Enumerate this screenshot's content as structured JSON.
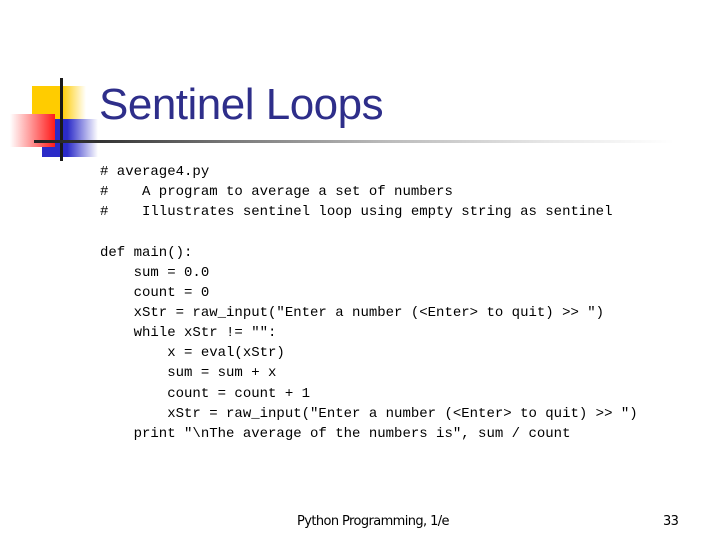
{
  "slide": {
    "title": "Sentinel Loops",
    "code_lines": [
      "# average4.py",
      "#    A program to average a set of numbers",
      "#    Illustrates sentinel loop using empty string as sentinel",
      "",
      "def main():",
      "    sum = 0.0",
      "    count = 0",
      "    xStr = raw_input(\"Enter a number (<Enter> to quit) >> \")",
      "    while xStr != \"\":",
      "        x = eval(xStr)",
      "        sum = sum + x",
      "        count = count + 1",
      "        xStr = raw_input(\"Enter a number (<Enter> to quit) >> \")",
      "    print \"\\nThe average of the numbers is\", sum / count"
    ],
    "footer": {
      "text": "Python Programming, 1/e",
      "page_number": "33"
    },
    "colors": {
      "title": "#2e2e8a",
      "logo_yellow": "#ffcc00",
      "logo_red": "#ff1a1a",
      "logo_blue": "#2b2bc8"
    },
    "icons": {
      "logo": "decorative-squares-logo"
    }
  }
}
